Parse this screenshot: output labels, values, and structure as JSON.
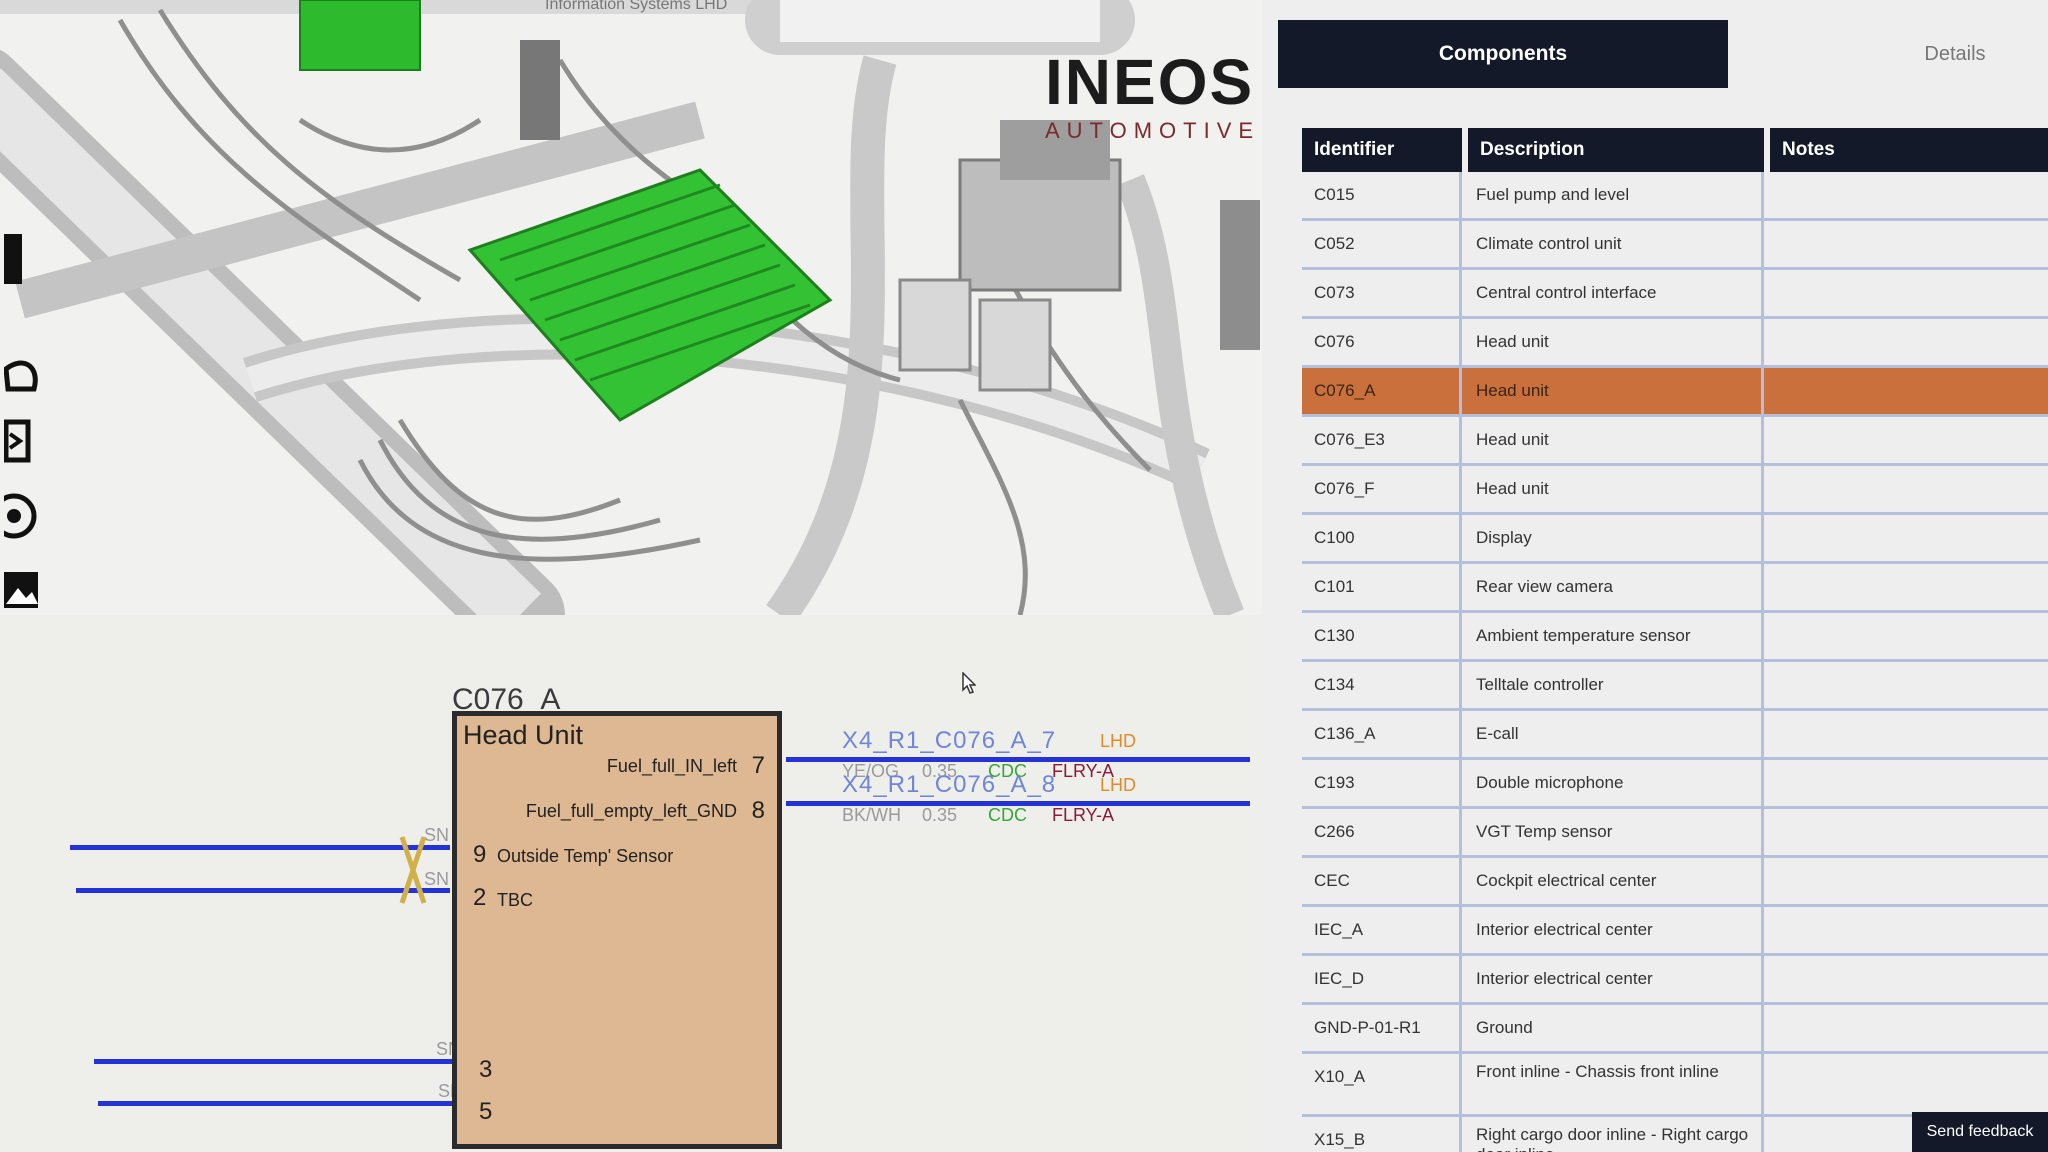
{
  "viewport": {
    "tab_title": "Information Systems LHD",
    "brand_name": "INEOS",
    "brand_sub": "AUTOMOTIVE"
  },
  "schematic": {
    "connector_id": "C076_A",
    "unit_title": "Head Unit",
    "pins_right": [
      {
        "name": "Fuel_full_IN_left",
        "num": "7"
      },
      {
        "name": "Fuel_full_empty_left_GND",
        "num": "8"
      }
    ],
    "pins_left": [
      {
        "num": "9",
        "name": "Outside Temp' Sensor"
      },
      {
        "num": "2",
        "name": "TBC"
      },
      {
        "num": "3",
        "name": ""
      },
      {
        "num": "5",
        "name": ""
      }
    ],
    "wires": [
      {
        "label": "X4_R1_C076_A_7",
        "code": "LHD",
        "color_code": "YE/OG",
        "size": "0.35",
        "cdc": "CDC",
        "type": "FLRY-A"
      },
      {
        "label": "X4_R1_C076_A_8",
        "code": "LHD",
        "color_code": "BK/WH",
        "size": "0.35",
        "cdc": "CDC",
        "type": "FLRY-A"
      }
    ],
    "shield_tag": "SN"
  },
  "panel": {
    "tabs": [
      "Components",
      "Details"
    ],
    "columns": [
      "Identifier",
      "Description",
      "Notes"
    ],
    "rows": [
      {
        "id": "C015",
        "desc": "Fuel pump and level",
        "note": ""
      },
      {
        "id": "C052",
        "desc": "Climate control unit",
        "note": ""
      },
      {
        "id": "C073",
        "desc": "Central control interface",
        "note": ""
      },
      {
        "id": "C076",
        "desc": "Head unit",
        "note": ""
      },
      {
        "id": "C076_A",
        "desc": "Head unit",
        "note": "",
        "selected": true
      },
      {
        "id": "C076_E3",
        "desc": "Head unit",
        "note": ""
      },
      {
        "id": "C076_F",
        "desc": "Head unit",
        "note": ""
      },
      {
        "id": "C100",
        "desc": "Display",
        "note": ""
      },
      {
        "id": "C101",
        "desc": "Rear view camera",
        "note": ""
      },
      {
        "id": "C130",
        "desc": "Ambient temperature sensor",
        "note": ""
      },
      {
        "id": "C134",
        "desc": "Telltale controller",
        "note": ""
      },
      {
        "id": "C136_A",
        "desc": "E-call",
        "note": ""
      },
      {
        "id": "C193",
        "desc": "Double microphone",
        "note": ""
      },
      {
        "id": "C266",
        "desc": "VGT Temp sensor",
        "note": ""
      },
      {
        "id": "CEC",
        "desc": "Cockpit electrical center",
        "note": ""
      },
      {
        "id": "IEC_A",
        "desc": "Interior electrical center",
        "note": ""
      },
      {
        "id": "IEC_D",
        "desc": "Interior electrical center",
        "note": ""
      },
      {
        "id": "GND-P-01-R1",
        "desc": "Ground",
        "note": ""
      },
      {
        "id": "X10_A",
        "desc": "Front inline - Chassis front inline",
        "note": ""
      },
      {
        "id": "X15_B",
        "desc": "Right cargo door inline - Right cargo door inline",
        "note": ""
      }
    ],
    "feedback_label": "Send feedback"
  },
  "rail_icons": [
    "pointer-icon",
    "hand-icon",
    "export-icon",
    "target-icon",
    "image-icon",
    "refresh-icon",
    "help-icon",
    "print-icon"
  ],
  "colors": {
    "header_bg": "#14192a",
    "selection": "#c9703c",
    "wire_blue": "#2432d8",
    "component_green": "#2dbb2d",
    "unit_box": "#ddb892"
  }
}
